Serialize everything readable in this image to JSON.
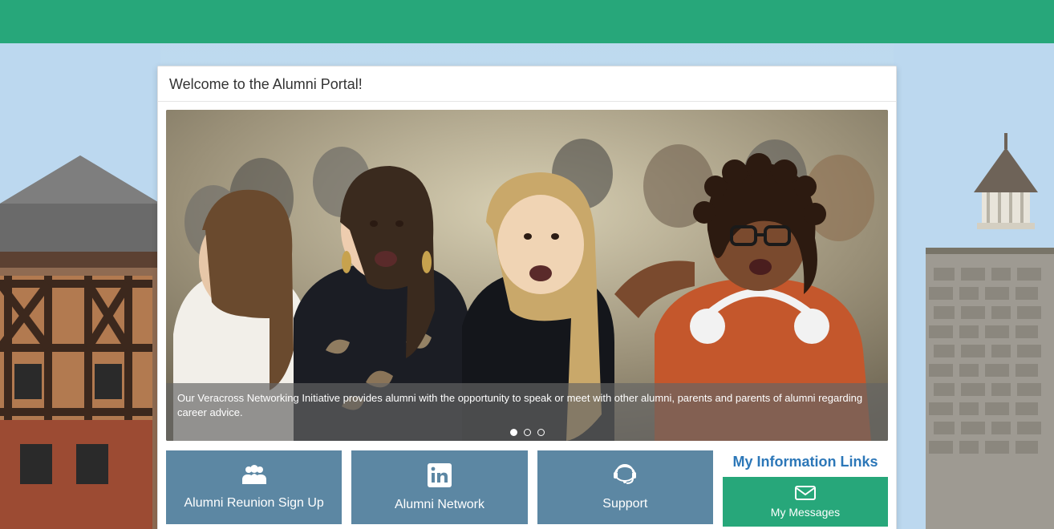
{
  "header": {
    "title": "Welcome to the Alumni Portal!"
  },
  "hero": {
    "caption": "Our Veracross Networking Initiative provides alumni with the opportunity to speak or meet with other alumni, parents and parents of alumni regarding career advice.",
    "slide_count": 3,
    "active_slide": 0
  },
  "tiles": [
    {
      "icon": "group-icon",
      "label": "Alumni Reunion Sign Up"
    },
    {
      "icon": "linkedin-icon",
      "label": "Alumni Network"
    },
    {
      "icon": "support-icon",
      "label": "Support"
    }
  ],
  "side": {
    "title": "My Information Links",
    "items": [
      {
        "icon": "mail-icon",
        "label": "My Messages"
      }
    ]
  },
  "colors": {
    "brand_green": "#27a77a",
    "tile_blue": "#5c87a3",
    "link_blue": "#2c77b8"
  }
}
